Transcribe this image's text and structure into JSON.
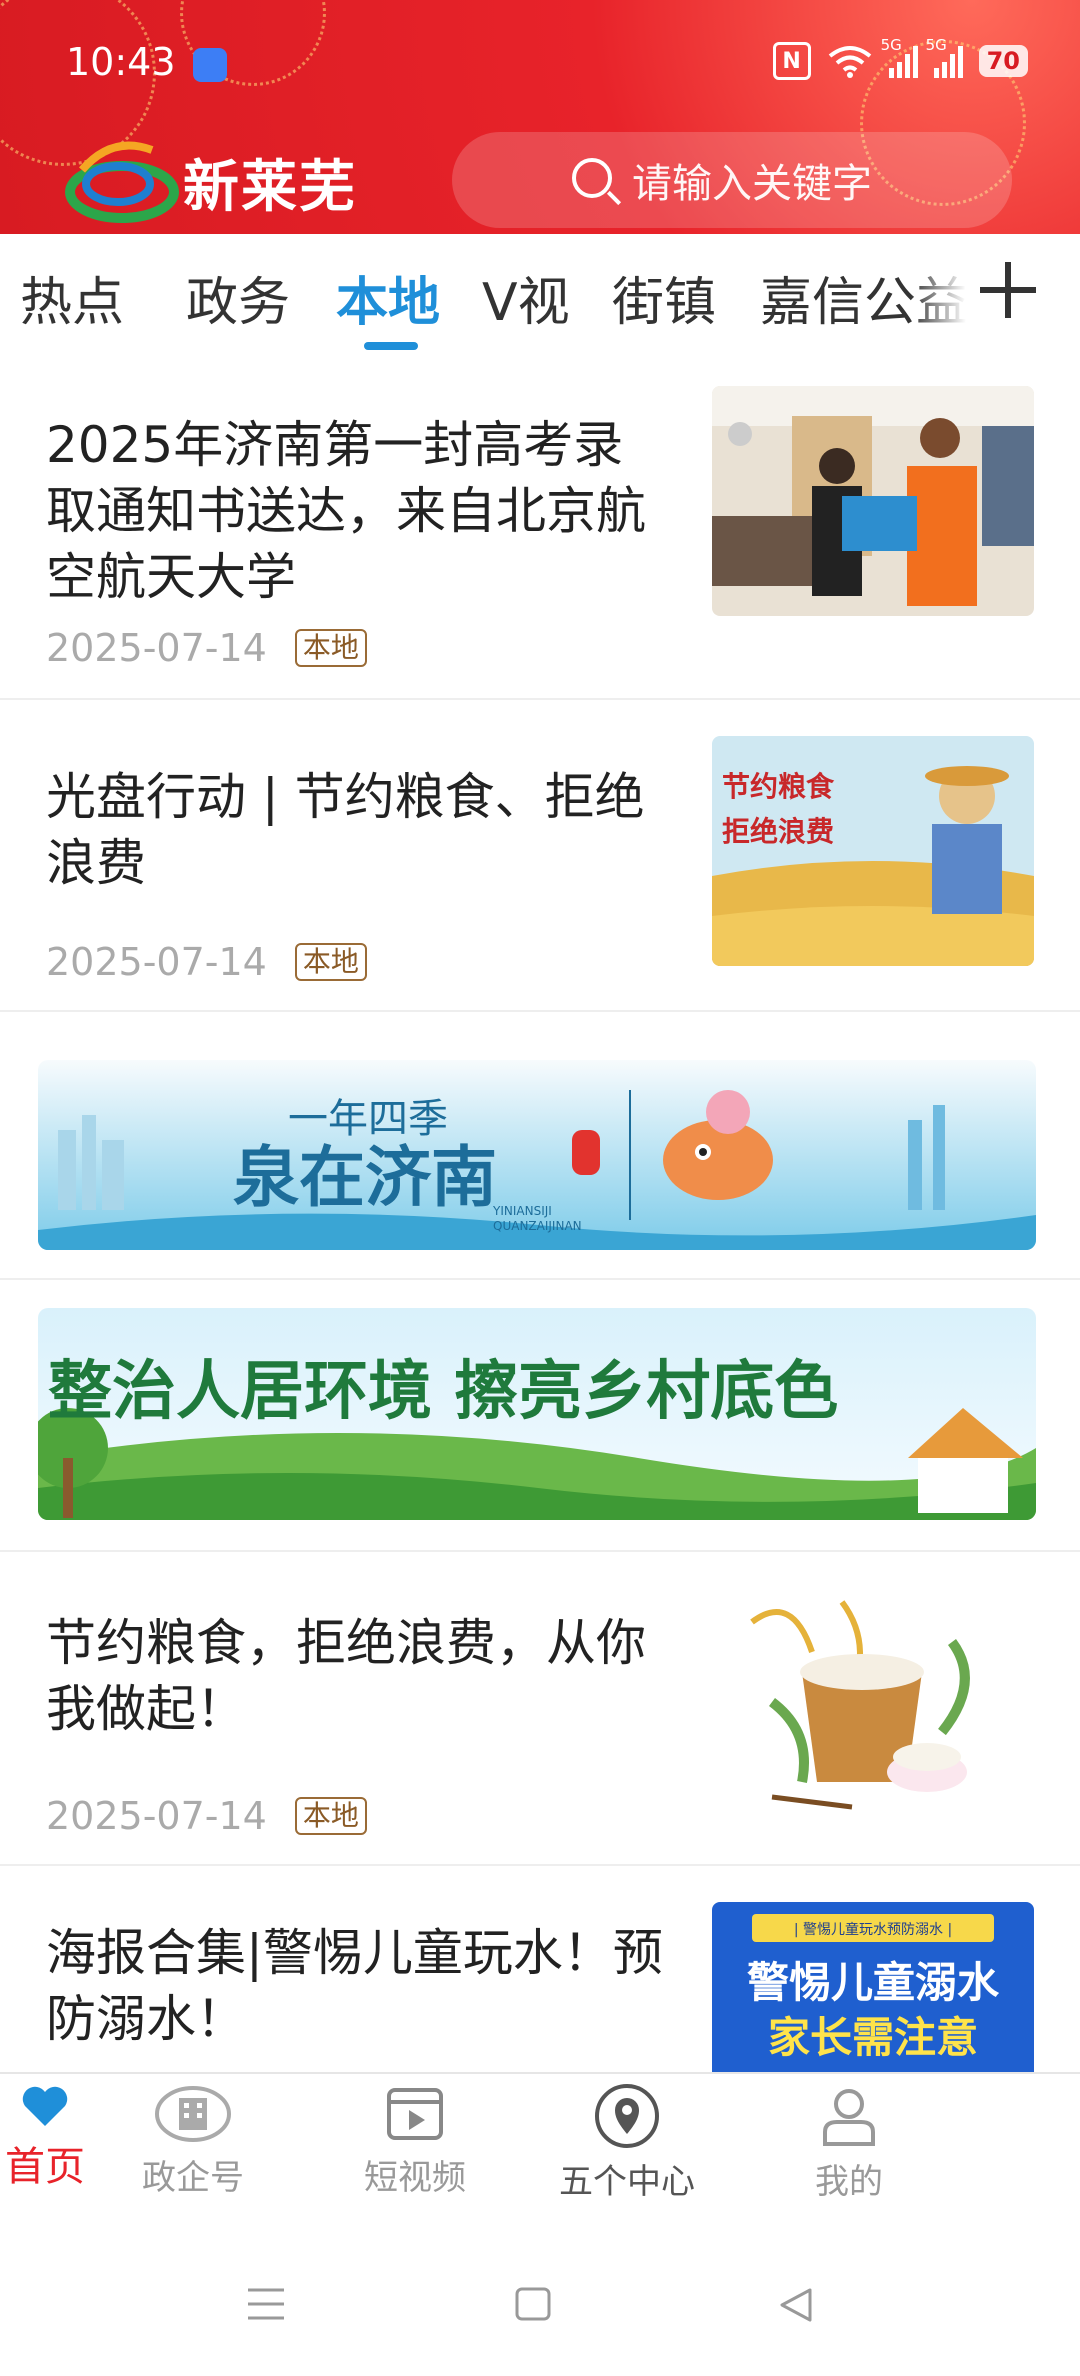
{
  "status": {
    "time": "10:43",
    "signal1": "5G",
    "signal2": "5G",
    "battery": "70"
  },
  "header": {
    "brand": "新莱芜",
    "search_placeholder": "请输入关键字"
  },
  "tabs": [
    {
      "label": "热点"
    },
    {
      "label": "政务"
    },
    {
      "label": "本地"
    },
    {
      "label": "V视"
    },
    {
      "label": "街镇"
    },
    {
      "label": "嘉信公益"
    }
  ],
  "active_tab": "本地",
  "news": [
    {
      "title": "2025年济南第一封高考录取通知书送达，来自北京航空航天大学",
      "date": "2025-07-14",
      "tag": "本地"
    },
    {
      "title": "光盘行动 | 节约粮食、拒绝浪费",
      "date": "2025-07-14",
      "tag": "本地",
      "image_text": [
        "节约粮食",
        "拒绝浪费"
      ]
    },
    {
      "title": "节约粮食，拒绝浪费，从你我做起！",
      "date": "2025-07-14",
      "tag": "本地"
    },
    {
      "title": "海报合集|警惕儿童玩水！预防溺水！",
      "image_text": [
        "| 警惕儿童玩水预防溺水 |",
        "警惕儿童溺水",
        "家长需注意"
      ]
    }
  ],
  "banners": [
    {
      "main": "泉在济南",
      "sub": "一年四季",
      "pinyin1": "YINIANSIJI",
      "pinyin2": "QUANZAIJINAN"
    },
    {
      "text": "整治人居环境  擦亮乡村底色"
    }
  ],
  "bottom_nav": [
    {
      "label": "首页",
      "icon": "heart-icon",
      "active": true
    },
    {
      "label": "政企号",
      "icon": "building-icon"
    },
    {
      "label": "短视频",
      "icon": "video-icon"
    },
    {
      "label": "五个中心",
      "icon": "location-pin-icon"
    },
    {
      "label": "我的",
      "icon": "person-icon"
    }
  ],
  "colors": {
    "brand_red": "#e8232a",
    "accent_blue": "#1f8fd9",
    "tag_brown": "#8a5a26"
  }
}
